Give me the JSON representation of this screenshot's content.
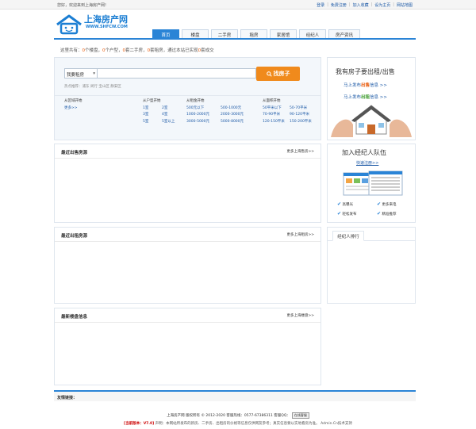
{
  "topbar": {
    "welcome": "您好，欢迎来到上海房产网!",
    "links": [
      "登录",
      "免费注册",
      "加入收藏",
      "设为主页",
      "网站地图"
    ]
  },
  "logo": {
    "title": "上海房产网",
    "url": "WWW.SHFCW.COM"
  },
  "nav": {
    "tabs": [
      "首页",
      "楼盘",
      "二手房",
      "租房",
      "家居馆",
      "经纪人",
      "房产资讯"
    ],
    "active": 0
  },
  "stats": {
    "prefix": "这里共有：",
    "n1": "0",
    "t1": "个楼盘，",
    "n2": "0",
    "t2": "个户型，",
    "n3": "0",
    "t3": "套二手房，",
    "n4": "0",
    "t4": "套租房，通过本站已实现",
    "n5": "0",
    "t5": "套成交"
  },
  "search": {
    "select": "我要租房",
    "button": "找房子",
    "hot": "热点推荐：浦东 闵行 宝山区 静安区"
  },
  "filters": {
    "area": {
      "title": "从区域开始",
      "more": "更多>>"
    },
    "room": {
      "title": "从户型开始",
      "items": [
        "1室",
        "2室",
        "3室",
        "4室",
        "5室",
        "5室以上"
      ]
    },
    "rent": {
      "title": "从租金开始",
      "items": [
        "500元以下",
        "500-1000元",
        "1000-2000元",
        "2000-3000元",
        "3000-5000元",
        "5000-8000元"
      ]
    },
    "size": {
      "title": "从面积开始",
      "items": [
        "50平米以下",
        "50-70平米",
        "70-90平米",
        "90-120平米",
        "120-150平米",
        "150-200平米"
      ]
    }
  },
  "side1": {
    "title": "我有房子要出租/出售",
    "line1a": "马上发布",
    "line1b": "出售",
    "line1c": "信息 >>",
    "line2a": "马上发布",
    "line2b": "出租",
    "line2c": "信息 >>"
  },
  "sections": [
    {
      "title": "最近出售房源",
      "more": "更多上海售房>>"
    },
    {
      "title": "最近出租房源",
      "more": "更多上海租房>>"
    },
    {
      "title": "最新楼盘信息",
      "more": "更多上海楼盘>>"
    }
  ],
  "side2": {
    "title": "加入经纪人队伍",
    "register": "快速注册>>",
    "features": [
      "高曝光",
      "更多来电",
      "轻松发布",
      "精准推荐"
    ]
  },
  "side3": {
    "tab": "经纪人排行"
  },
  "friend": {
    "label": "友情链接："
  },
  "footer": {
    "line1": "上海房产网 版权所有 © 2012-2020 客服热线：0577-67386311 客服QQ：",
    "stamp": "在线客服",
    "version_label": "[当前版本：V7.0]",
    "line2": "声明：本网站所发布的新房、二手房、出租房的价格等信息仅供网友参考；真实信息要以实地看房为准。 Admin.Cn技术支持"
  },
  "colors": {
    "accent": "#2a84d6",
    "orange": "#f08a1c",
    "link": "#1c59a6"
  }
}
